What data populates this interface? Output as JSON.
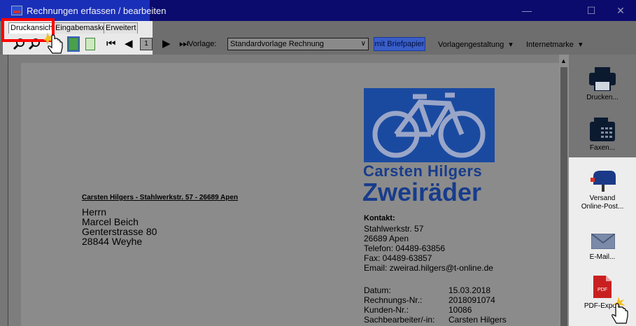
{
  "window": {
    "title": "Rechnungen erfassen / bearbeiten",
    "minimize_glyph": "—",
    "maximize_glyph": "☐",
    "close_glyph": "✕"
  },
  "tabs": [
    {
      "label": "Druckansicht",
      "active": true
    },
    {
      "label": "Eingabemaske",
      "active": false
    },
    {
      "label": "Erweitert",
      "active": false
    }
  ],
  "toolbar": {
    "page_number": "1",
    "vorlage_label": "Vorlage:",
    "vorlage_value": "Standardvorlage Rechnung",
    "briefpapier_label": "mit Briefpapier",
    "vorlagengestaltung_label": "Vorlagengestaltung",
    "internetmarke_label": "Internetmarke",
    "dropdown_glyph": "▾"
  },
  "document": {
    "logo_line1": "Carsten Hilgers",
    "logo_line2": "Zweiräder",
    "sender_line": "Carsten Hilgers - Stahlwerkstr. 57 - 26689 Apen",
    "recipient": [
      "Herrn",
      "Marcel Beich",
      "Genterstrasse 80",
      "28844 Weyhe"
    ],
    "kontakt_heading": "Kontakt:",
    "kontakt_lines": [
      "Stahlwerkstr. 57",
      "26689 Apen",
      "Telefon: 04489-63856",
      "Fax: 04489-63857",
      "Email: zweirad.hilgers@t-online.de"
    ],
    "meta": [
      {
        "key": "Datum:",
        "value": "15.03.2018"
      },
      {
        "key": "Rechnungs-Nr.:",
        "value": "2018091074"
      },
      {
        "key": "Kunden-Nr.:",
        "value": "10086"
      },
      {
        "key": "Sachbearbeiter/-in:",
        "value": "Carsten Hilgers"
      }
    ]
  },
  "sidebar": {
    "drucken": "Drucken...",
    "faxen": "Faxen...",
    "versand_line1": "Versand",
    "versand_line2": "Online-Post...",
    "email": "E-Mail...",
    "pdf": "PDF-Export",
    "pdf_icon_text": "PDF"
  },
  "colors": {
    "titlebar": "#0b0b6e",
    "highlight_red": "#ff0000",
    "logo_blue": "#1a4aa0",
    "pdf_red": "#c82020"
  }
}
